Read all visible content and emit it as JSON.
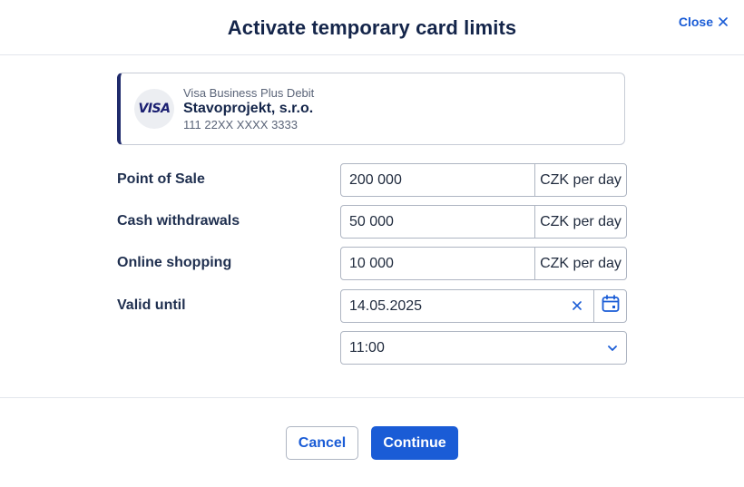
{
  "dialog": {
    "title": "Activate temporary card limits",
    "close_label": "Close",
    "close_icon": "x-icon"
  },
  "card": {
    "brand": "VISA",
    "type": "Visa Business Plus Debit",
    "holder": "Stavoprojekt, s.r.o.",
    "number": "111 22XX XXXX 3333"
  },
  "limits": {
    "pos": {
      "label": "Point of Sale",
      "value": "200 000",
      "unit": "CZK per day"
    },
    "cash": {
      "label": "Cash withdrawals",
      "value": "50 000",
      "unit": "CZK per day"
    },
    "online": {
      "label": "Online shopping",
      "value": "10 000",
      "unit": "CZK per day"
    }
  },
  "valid_until": {
    "label": "Valid until",
    "date": "14.05.2025",
    "time": "11:00"
  },
  "footer": {
    "cancel_label": "Cancel",
    "continue_label": "Continue"
  },
  "colors": {
    "accent": "#1a5cd6",
    "title": "#14254a",
    "card_stripe": "#1f2a6b"
  }
}
